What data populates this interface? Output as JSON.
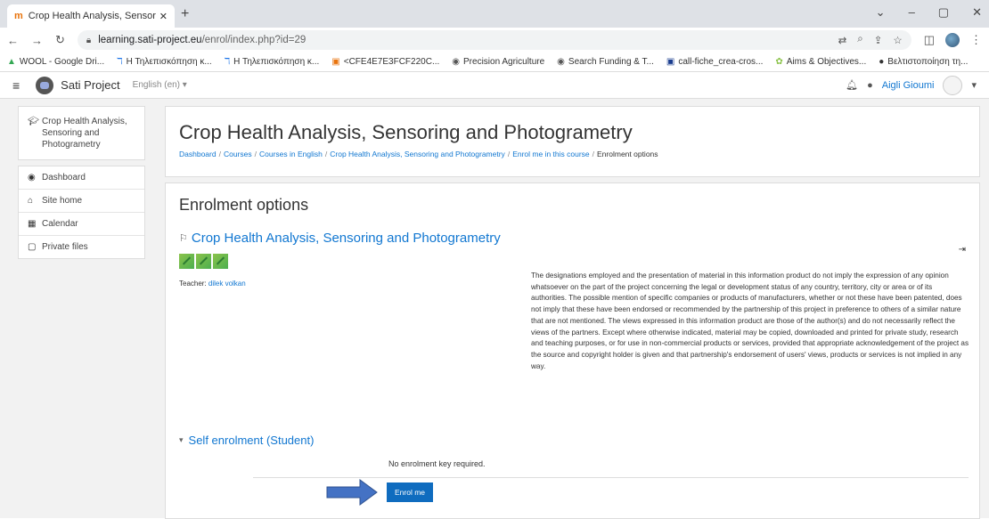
{
  "browser": {
    "tab_title": "Crop Health Analysis, Sensoring",
    "tab_close": "✕",
    "new_tab": "+",
    "url_host": "learning.sati-project.eu",
    "url_path": "/enrol/index.php?id=29",
    "bookmarks": [
      {
        "icon": "drive-icon",
        "glyph": "▲",
        "color": "#34a853",
        "label": "WOOL - Google Dri..."
      },
      {
        "icon": "page-icon",
        "glyph": "ℸ",
        "color": "#1a73e8",
        "label": "Η Τηλεπισκόπηση κ..."
      },
      {
        "icon": "page-icon",
        "glyph": "ℸ",
        "color": "#1a73e8",
        "label": "Η Τηλεπισκόπηση κ..."
      },
      {
        "icon": "doc-icon",
        "glyph": "▣",
        "color": "#e8730c",
        "label": "<CFE4E7E3FCF220C..."
      },
      {
        "icon": "globe-icon",
        "glyph": "◉",
        "color": "#555",
        "label": "Precision Agriculture"
      },
      {
        "icon": "globe-icon",
        "glyph": "◉",
        "color": "#555",
        "label": "Search Funding & T..."
      },
      {
        "icon": "eu-icon",
        "glyph": "▣",
        "color": "#1a3d8f",
        "label": "call-fiche_crea-cros..."
      },
      {
        "icon": "leaf-icon",
        "glyph": "✿",
        "color": "#8bc34a",
        "label": "Aims & Objectives..."
      },
      {
        "icon": "site-icon",
        "glyph": "●",
        "color": "#333",
        "label": "Βελτιστοποίηση τη..."
      }
    ]
  },
  "navbar": {
    "site_name": "Sati Project",
    "language": "English (en) ▾",
    "user_name": "Aigli Gioumi"
  },
  "sidebar": {
    "course": "Crop Health Analysis, Sensoring and Photogrametry",
    "items": [
      {
        "label": "Dashboard",
        "icon": "dashboard-icon",
        "glyph": "◉"
      },
      {
        "label": "Site home",
        "icon": "home-icon",
        "glyph": "⌂"
      },
      {
        "label": "Calendar",
        "icon": "calendar-icon",
        "glyph": "▦"
      },
      {
        "label": "Private files",
        "icon": "file-icon",
        "glyph": "▢"
      }
    ]
  },
  "header": {
    "title": "Crop Health Analysis, Sensoring and Photogrametry",
    "breadcrumb": [
      "Dashboard",
      "Courses",
      "Courses in English",
      "Crop Health Analysis, Sensoring and Photogrametry",
      "Enrol me in this course"
    ],
    "breadcrumb_current": "Enrolment options"
  },
  "content": {
    "heading": "Enrolment options",
    "course_title": "Crop Health Analysis, Sensoring and Photogrametry",
    "teacher_label": "Teacher: ",
    "teacher_name": "dilek volkan",
    "summary": "The designations employed and the presentation of material in this information product do not imply the expression of any opinion whatsoever on the part of the project concerning the legal or development status of any country, territory, city or area or of its authorities. The possible mention of specific companies or products of manufacturers, whether or not these have been patented, does not imply that these have been endorsed or recommended by the partnership of this project in preference to others of a similar nature that are not mentioned. The views expressed in this information product are those of the author(s) and do not necessarily reflect the views of the partners. Except where otherwise indicated, material may be copied, downloaded and printed for private study, research and teaching purposes, or for use in non-commercial products or services, provided that appropriate acknowledgement of the project as the source and copyright holder is given and that partnership's endorsement of users' views, products or services is not implied in any way.",
    "self_enrol_heading": "Self enrolment (Student)",
    "no_key": "No enrolment key required.",
    "enrol_button": "Enrol me"
  },
  "colors": {
    "link": "#1177d1",
    "button": "#0f6cbf",
    "arrow": "#4472c4"
  }
}
